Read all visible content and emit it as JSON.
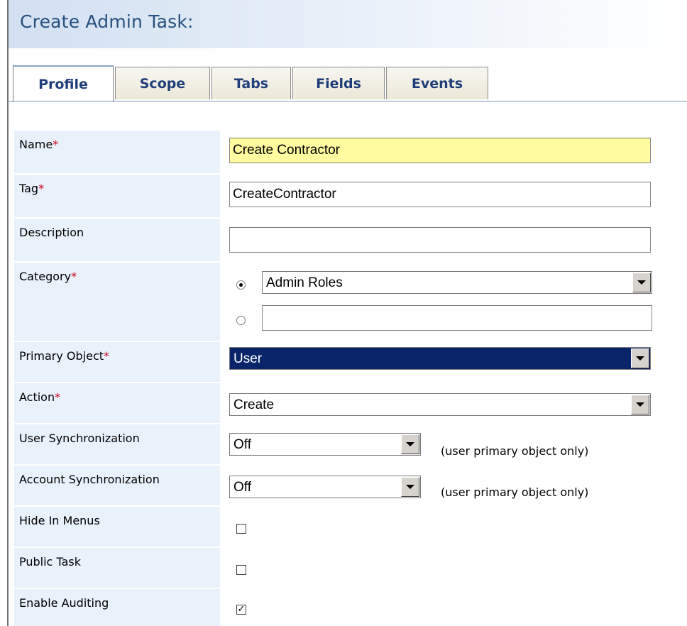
{
  "page": {
    "title": "Create Admin Task:"
  },
  "tabs": [
    {
      "label": "Profile",
      "active": true
    },
    {
      "label": "Scope",
      "active": false
    },
    {
      "label": "Tabs",
      "active": false
    },
    {
      "label": "Fields",
      "active": false
    },
    {
      "label": "Events",
      "active": false
    }
  ],
  "form": {
    "required_marker": "*",
    "name": {
      "label": "Name",
      "value": "Create Contractor"
    },
    "tag": {
      "label": "Tag",
      "value": "CreateContractor"
    },
    "description": {
      "label": "Description",
      "value": ""
    },
    "category": {
      "label": "Category",
      "selected_option": "Admin Roles",
      "new_value": ""
    },
    "primary_object": {
      "label": "Primary Object",
      "value": "User"
    },
    "action": {
      "label": "Action",
      "value": "Create"
    },
    "user_sync": {
      "label": "User Synchronization",
      "value": "Off",
      "note": "(user primary object only)"
    },
    "account_sync": {
      "label": "Account Synchronization",
      "value": "Off",
      "note": "(user primary object only)"
    },
    "hide_in_menus": {
      "label": "Hide In Menus",
      "checked": false
    },
    "public_task": {
      "label": "Public Task",
      "checked": false
    },
    "enable_auditing": {
      "label": "Enable Auditing",
      "checked": true,
      "check_glyph": "✓"
    }
  },
  "colors": {
    "title": "#27507e",
    "label_bg": "#e9f1fb",
    "required": "#d0021b",
    "highlight": "#fffb9f",
    "selected_select": "#0a246a"
  }
}
